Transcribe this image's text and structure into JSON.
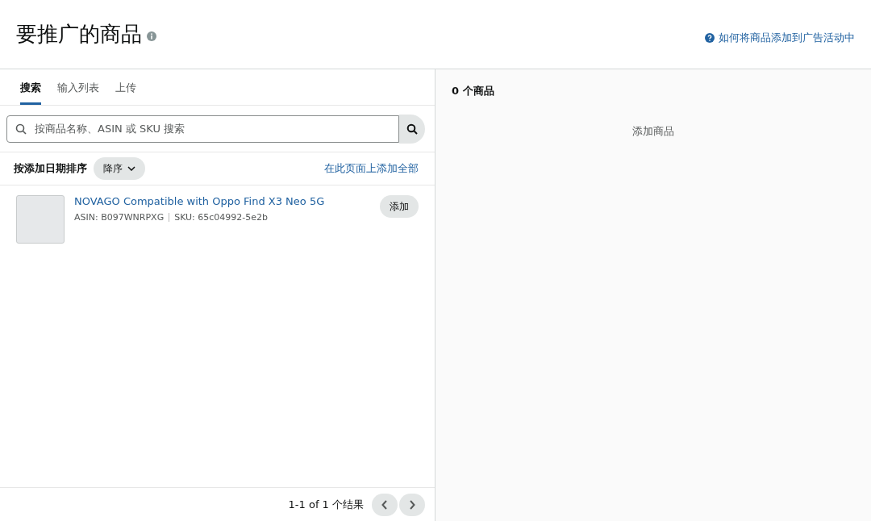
{
  "header": {
    "title": "要推广的商品",
    "help_link": "如何将商品添加到广告活动中"
  },
  "tabs": [
    {
      "label": "搜索",
      "selected": true
    },
    {
      "label": "输入列表",
      "selected": false
    },
    {
      "label": "上传",
      "selected": false
    }
  ],
  "search": {
    "placeholder": "按商品名称、ASIN 或 SKU 搜索"
  },
  "sort": {
    "label": "按添加日期排序",
    "order": "降序",
    "add_all": "在此页面上添加全部"
  },
  "products": [
    {
      "title": "NOVAGO Compatible with Oppo Find X3 Neo 5G",
      "asin": "ASIN: B097WNRPXG",
      "sku": "SKU: 65c04992-5e2b",
      "button": "添加"
    }
  ],
  "pagination": {
    "summary": "1-1 of 1 个结果"
  },
  "selected_panel": {
    "count": "0 个商品",
    "empty": "添加商品"
  }
}
